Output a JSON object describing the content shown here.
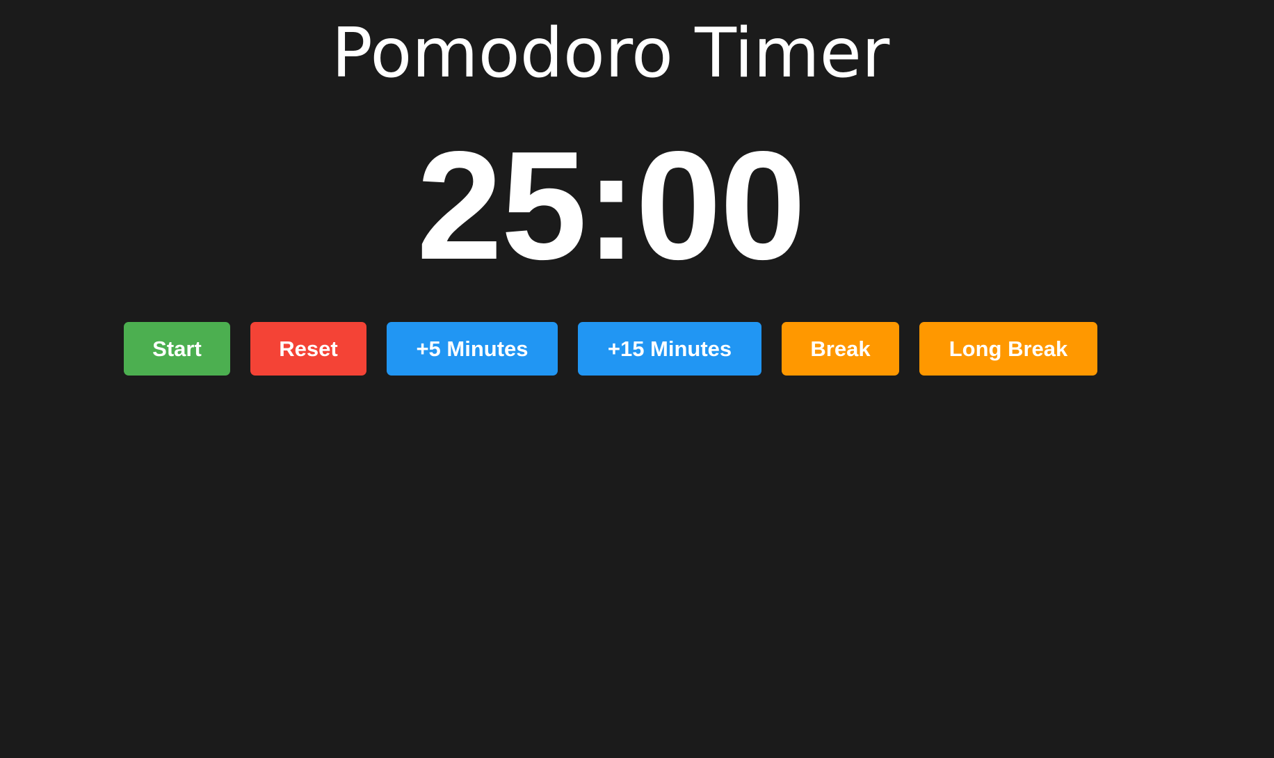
{
  "app": {
    "title": "Pomodoro Timer"
  },
  "timer": {
    "display": "25:00"
  },
  "controls": {
    "start_label": "Start",
    "reset_label": "Reset",
    "plus5_label": "+5 Minutes",
    "plus15_label": "+15 Minutes",
    "break_label": "Break",
    "long_break_label": "Long Break"
  },
  "colors": {
    "background": "#1b1b1b",
    "start": "#4caf50",
    "reset": "#f44336",
    "add_time": "#2196f3",
    "break": "#ff9800",
    "text": "#ffffff"
  }
}
